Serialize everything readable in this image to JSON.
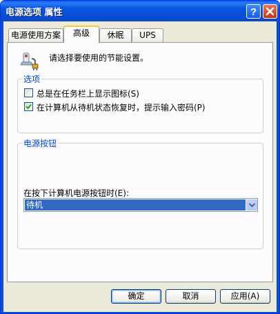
{
  "window": {
    "title": "电源选项 属性"
  },
  "title_buttons": {
    "help": "?",
    "close": "close-icon"
  },
  "tabs": [
    {
      "label": "电源使用方案",
      "active": false
    },
    {
      "label": "高级",
      "active": true
    },
    {
      "label": "休眠",
      "active": false
    },
    {
      "label": "UPS",
      "active": false
    }
  ],
  "intro": {
    "text": "请选择要使用的节能设置。",
    "icon": "power-options-icon"
  },
  "options_group": {
    "legend": "选项",
    "checkboxes": [
      {
        "label": "总是在任务栏上显示图标(S)",
        "checked": false
      },
      {
        "label": "在计算机从待机状态恢复时，提示输入密码(P)",
        "checked": true
      }
    ]
  },
  "power_buttons_group": {
    "legend": "电源按钮",
    "dropdown_label": "在按下计算机电源按钮时(E):",
    "dropdown_value": "待机"
  },
  "buttons": {
    "ok": "确定",
    "cancel": "取消",
    "apply": "应用(A)"
  },
  "colors": {
    "titlebar": "#0a4ed6",
    "group_legend": "#0046d5",
    "selection": "#316ac5",
    "dialog_bg": "#ece9d8"
  }
}
